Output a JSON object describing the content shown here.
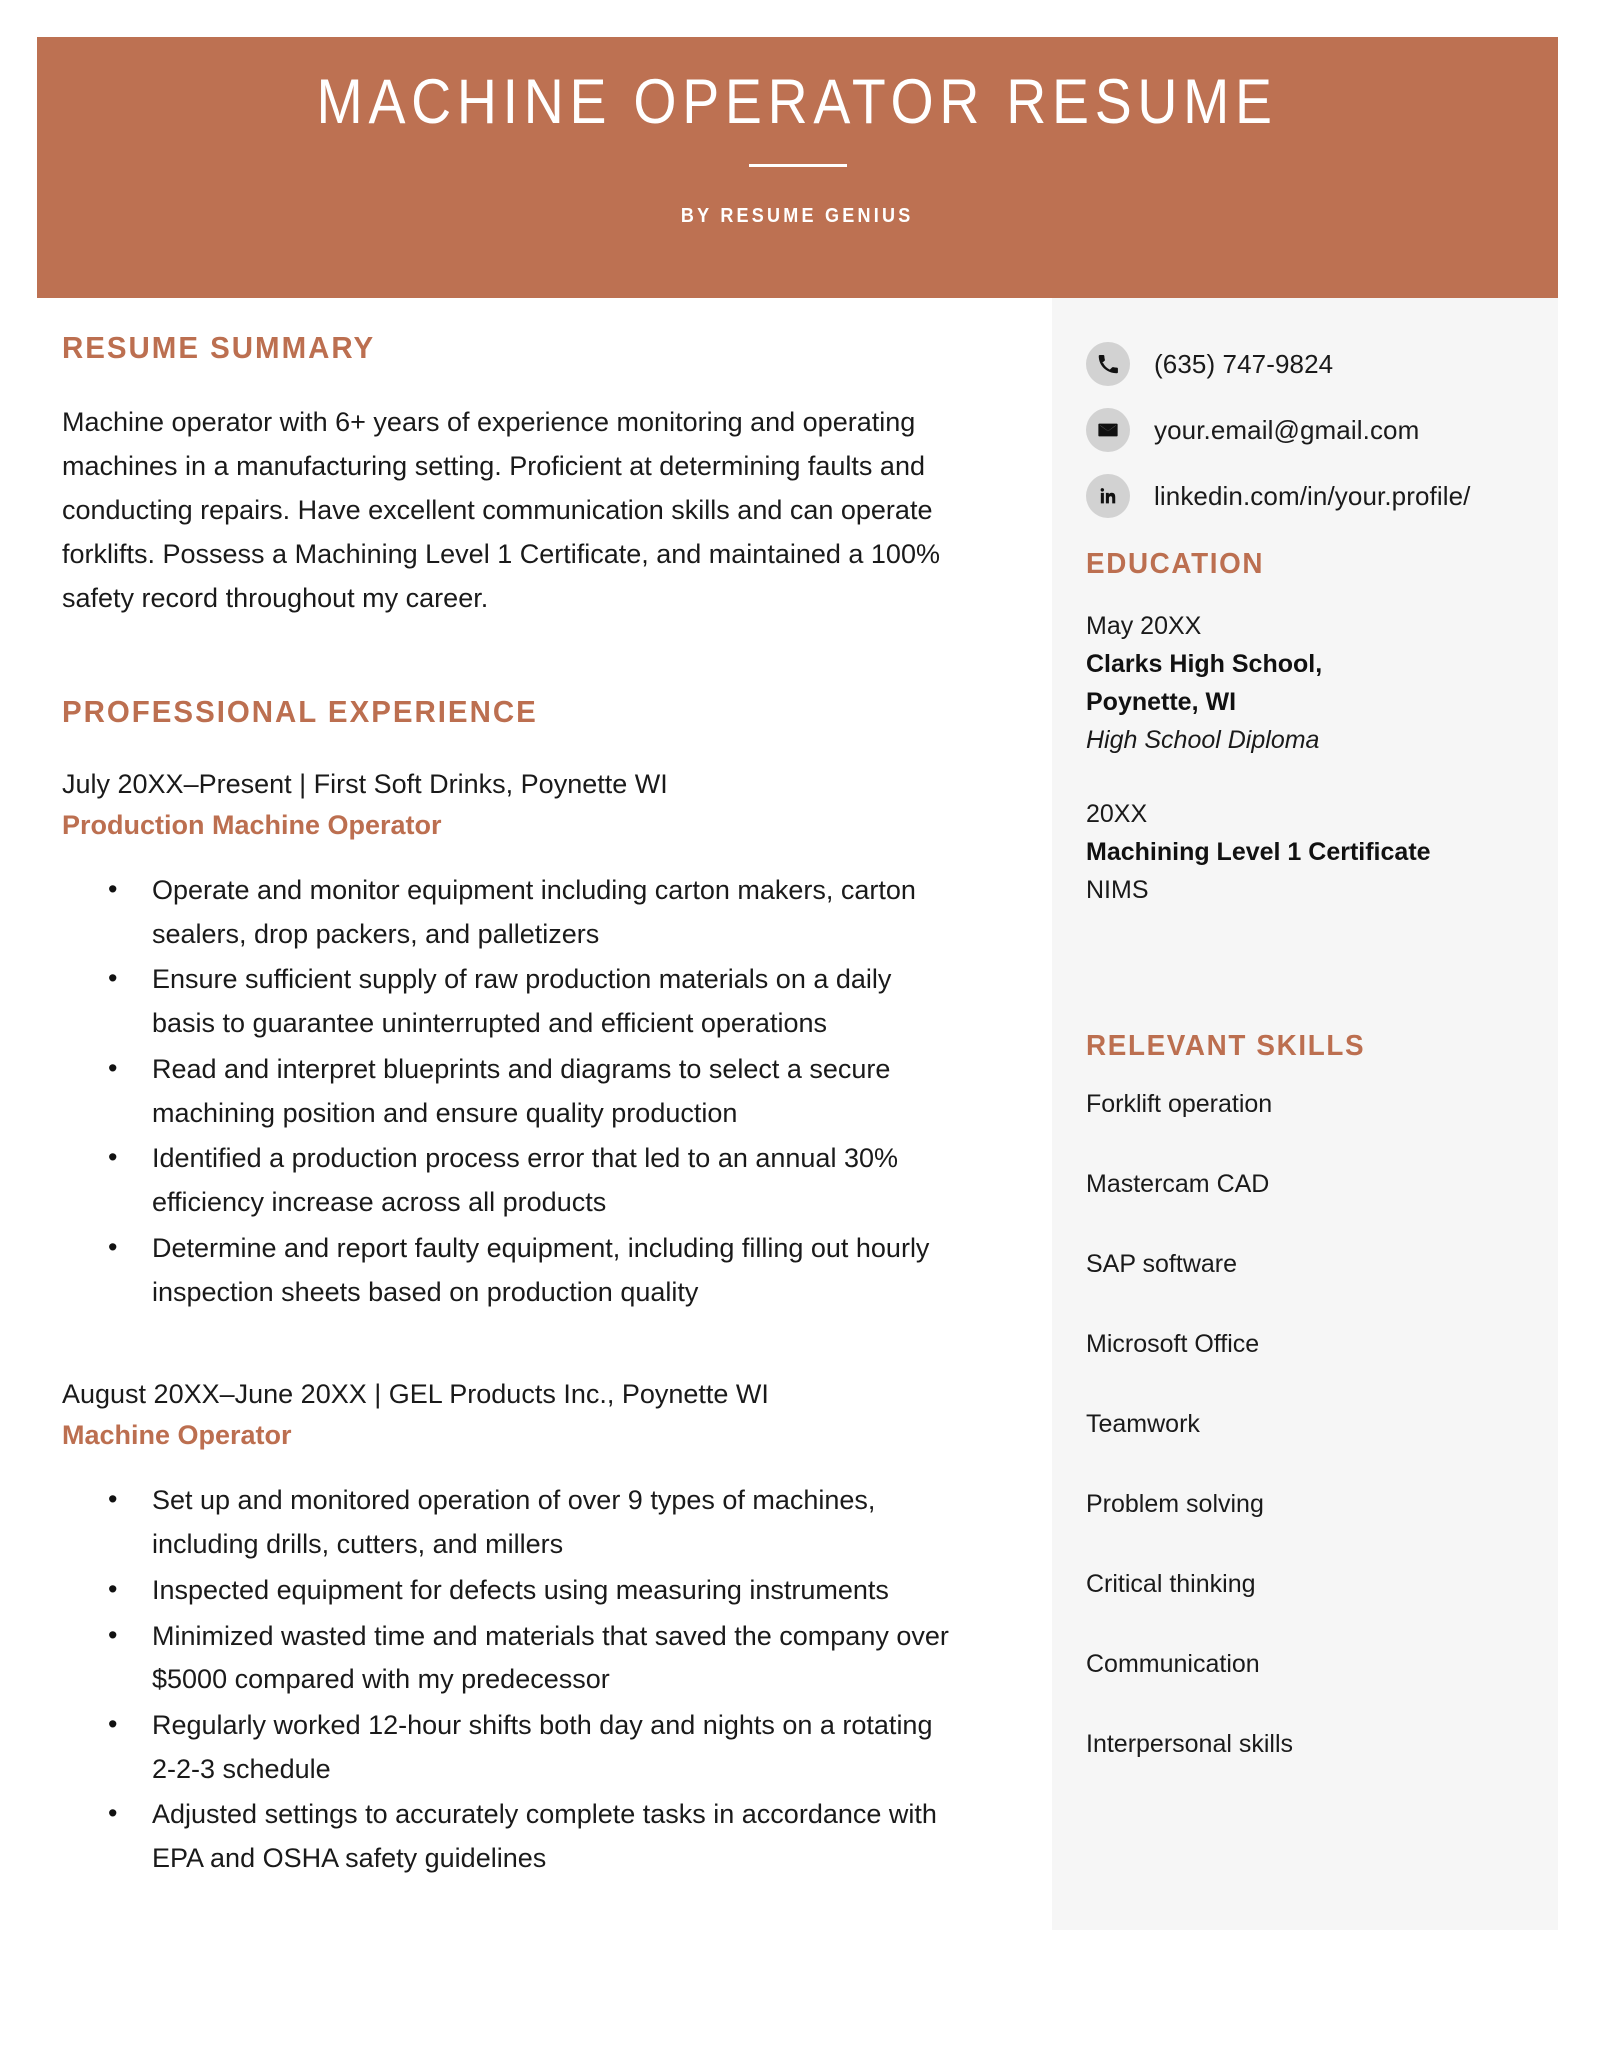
{
  "colors": {
    "accent": "#bd7152",
    "heading_accent": "#bc6f50",
    "sidebar_bg": "#f6f6f6",
    "badge_bg": "#d2d2d2",
    "text": "#1a1a1a"
  },
  "banner": {
    "title": "MACHINE OPERATOR RESUME",
    "subtitle": "BY RESUME GENIUS"
  },
  "sidebar": {
    "contacts": [
      {
        "icon": "phone-icon",
        "value": "(635) 747-9824"
      },
      {
        "icon": "envelope-icon",
        "value": "your.email@gmail.com"
      },
      {
        "icon": "linkedin-icon",
        "value": "linkedin.com/in/your.profile/"
      }
    ],
    "education": {
      "heading": "EDUCATION",
      "entries": [
        {
          "date": "May 20XX",
          "school_line1": "Clarks High School,",
          "school_line2": "Poynette, WI",
          "degree": "High School Diploma"
        },
        {
          "date": "20XX",
          "school_line1": "Machining Level 1 Certificate",
          "org": "NIMS"
        }
      ]
    },
    "skills": {
      "heading": "RELEVANT SKILLS",
      "items": [
        "Forklift operation",
        "Mastercam CAD",
        "SAP software",
        "Microsoft Office",
        "Teamwork",
        "Problem solving",
        "Critical thinking",
        "Communication",
        "Interpersonal skills"
      ]
    }
  },
  "main": {
    "summary": {
      "heading": "RESUME SUMMARY",
      "text": "Machine operator with 6+ years of experience monitoring and operating machines in a manufacturing setting. Proficient at determining faults and conducting repairs. Have excellent communication skills and can operate forklifts. Possess a Machining Level 1 Certificate, and maintained a 100% safety record throughout my career."
    },
    "experience": {
      "heading": "PROFESSIONAL EXPERIENCE",
      "jobs": [
        {
          "meta": "July 20XX–Present | First Soft Drinks, Poynette WI",
          "title": "Production Machine Operator",
          "bullets": [
            "Operate and monitor equipment including carton makers, carton sealers, drop packers, and palletizers",
            "Ensure sufficient supply of raw production materials on a daily basis to guarantee uninterrupted and efficient operations",
            "Read and interpret blueprints and diagrams to select a secure machining position and ensure quality production",
            "Identified a production process error that led to an annual 30% efficiency increase across all products",
            "Determine and report faulty equipment, including filling out hourly inspection sheets based on production quality"
          ]
        },
        {
          "meta": "August 20XX–June 20XX | GEL Products Inc., Poynette WI",
          "title": "Machine Operator",
          "bullets": [
            "Set up and monitored operation of over 9 types of machines, including drills, cutters, and millers",
            "Inspected equipment for defects using measuring instruments",
            "Minimized wasted time and materials that saved the company over $5000 compared with my predecessor",
            "Regularly worked 12-hour shifts both day and nights on a rotating 2-2-3 schedule",
            "Adjusted settings to accurately complete tasks in accordance with EPA and OSHA safety guidelines"
          ]
        }
      ]
    }
  }
}
